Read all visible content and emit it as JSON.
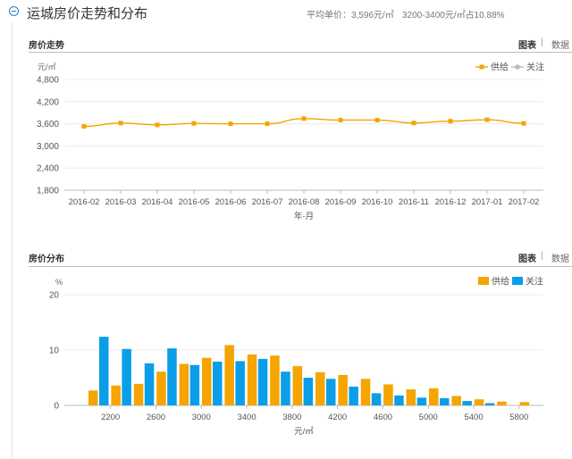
{
  "header": {
    "title": "运城房价走势和分布",
    "avg_price": "平均单价：3,596元/㎡",
    "range_share": "3200-3400元/㎡占10.88%"
  },
  "colors": {
    "supply": "#f5a400",
    "attention": "#0b9ee8",
    "attention_line": "#bbbbbb",
    "accent": "#1d7fd1"
  },
  "tabs": {
    "chart": "图表",
    "data": "数据",
    "separator": "|"
  },
  "trend_section": {
    "title": "房价走势"
  },
  "dist_section": {
    "title": "房价分布"
  },
  "chart_data": [
    {
      "type": "line",
      "title": "房价走势",
      "ylabel": "元/㎡",
      "xlabel": "年-月",
      "ylim": [
        1800,
        4800
      ],
      "yticks": [
        "4,800",
        "4,200",
        "3,600",
        "3,000",
        "2,400",
        "1,800"
      ],
      "ytick_values": [
        4800,
        4200,
        3600,
        3000,
        2400,
        1800
      ],
      "x": [
        "2016-02",
        "2016-03",
        "2016-04",
        "2016-05",
        "2016-06",
        "2016-07",
        "2016-08",
        "2016-09",
        "2016-10",
        "2016-11",
        "2016-12",
        "2017-01",
        "2017-02"
      ],
      "legend": [
        "供给",
        "关注"
      ],
      "series": [
        {
          "name": "供给",
          "values": [
            3530,
            3620,
            3570,
            3610,
            3600,
            3600,
            3740,
            3700,
            3700,
            3620,
            3670,
            3710,
            3610
          ]
        }
      ],
      "grid": true
    },
    {
      "type": "bar",
      "title": "房价分布",
      "ylabel": "%",
      "xlabel": "元/㎡",
      "ylim": [
        0,
        20
      ],
      "yticks": [
        "20",
        "10",
        "0"
      ],
      "ytick_values": [
        20,
        10,
        0
      ],
      "categories": [
        2200,
        2400,
        2600,
        2800,
        3000,
        3200,
        3400,
        3600,
        3800,
        4000,
        4200,
        4400,
        4600,
        4800,
        5000,
        5200,
        5400,
        5600,
        5800
      ],
      "xtick_labels": [
        "2200",
        "2600",
        "3000",
        "3400",
        "3800",
        "4200",
        "4600",
        "5000",
        "5400",
        "5800"
      ],
      "legend": [
        "供给",
        "关注"
      ],
      "series": [
        {
          "name": "供给",
          "values": [
            2.7,
            3.6,
            3.9,
            6.1,
            7.5,
            8.6,
            10.9,
            9.2,
            9.0,
            7.1,
            6.0,
            5.5,
            4.8,
            3.8,
            2.9,
            3.1,
            1.7,
            1.1,
            0.7,
            0.6
          ]
        },
        {
          "name": "关注",
          "values": [
            12.4,
            10.2,
            7.6,
            10.3,
            7.3,
            7.9,
            8.0,
            8.4,
            6.1,
            5.0,
            4.8,
            3.4,
            2.2,
            1.8,
            1.4,
            1.3,
            0.8,
            0.4,
            0.0,
            0.0
          ]
        }
      ],
      "grid": true
    }
  ]
}
